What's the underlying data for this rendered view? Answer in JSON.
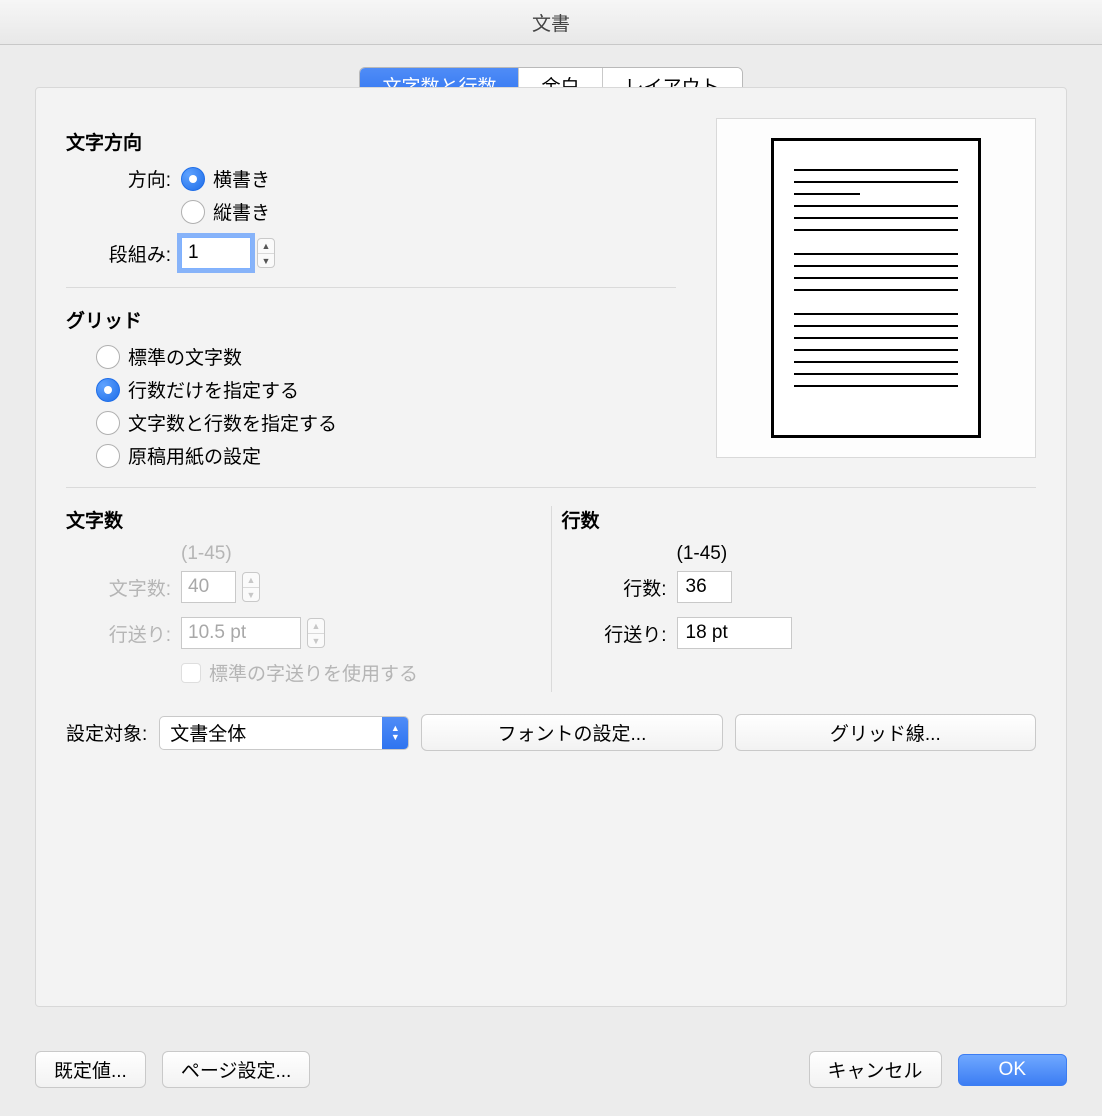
{
  "window": {
    "title": "文書"
  },
  "tabs": {
    "chars_lines": "文字数と行数",
    "margins": "余白",
    "layout": "レイアウト"
  },
  "text_direction": {
    "heading": "文字方向",
    "direction_label": "方向:",
    "horizontal": "横書き",
    "vertical": "縦書き",
    "columns_label": "段組み:",
    "columns_value": "1"
  },
  "grid": {
    "heading": "グリッド",
    "opt_standard": "標準の文字数",
    "opt_lines_only": "行数だけを指定する",
    "opt_chars_lines": "文字数と行数を指定する",
    "opt_manuscript": "原稿用紙の設定"
  },
  "chars_section": {
    "heading": "文字数",
    "range": "(1-45)",
    "chars_label": "文字数:",
    "chars_value": "40",
    "pitch_label": "行送り:",
    "pitch_value": "10.5 pt",
    "use_default_pitch": "標準の字送りを使用する"
  },
  "lines_section": {
    "heading": "行数",
    "range": "(1-45)",
    "lines_label": "行数:",
    "lines_value": "36",
    "pitch_label": "行送り:",
    "pitch_value": "18 pt"
  },
  "apply_to": {
    "label": "設定対象:",
    "value": "文書全体"
  },
  "buttons": {
    "font_settings": "フォントの設定...",
    "grid_lines": "グリッド線...",
    "default": "既定値...",
    "page_setup": "ページ設定...",
    "cancel": "キャンセル",
    "ok": "OK"
  }
}
